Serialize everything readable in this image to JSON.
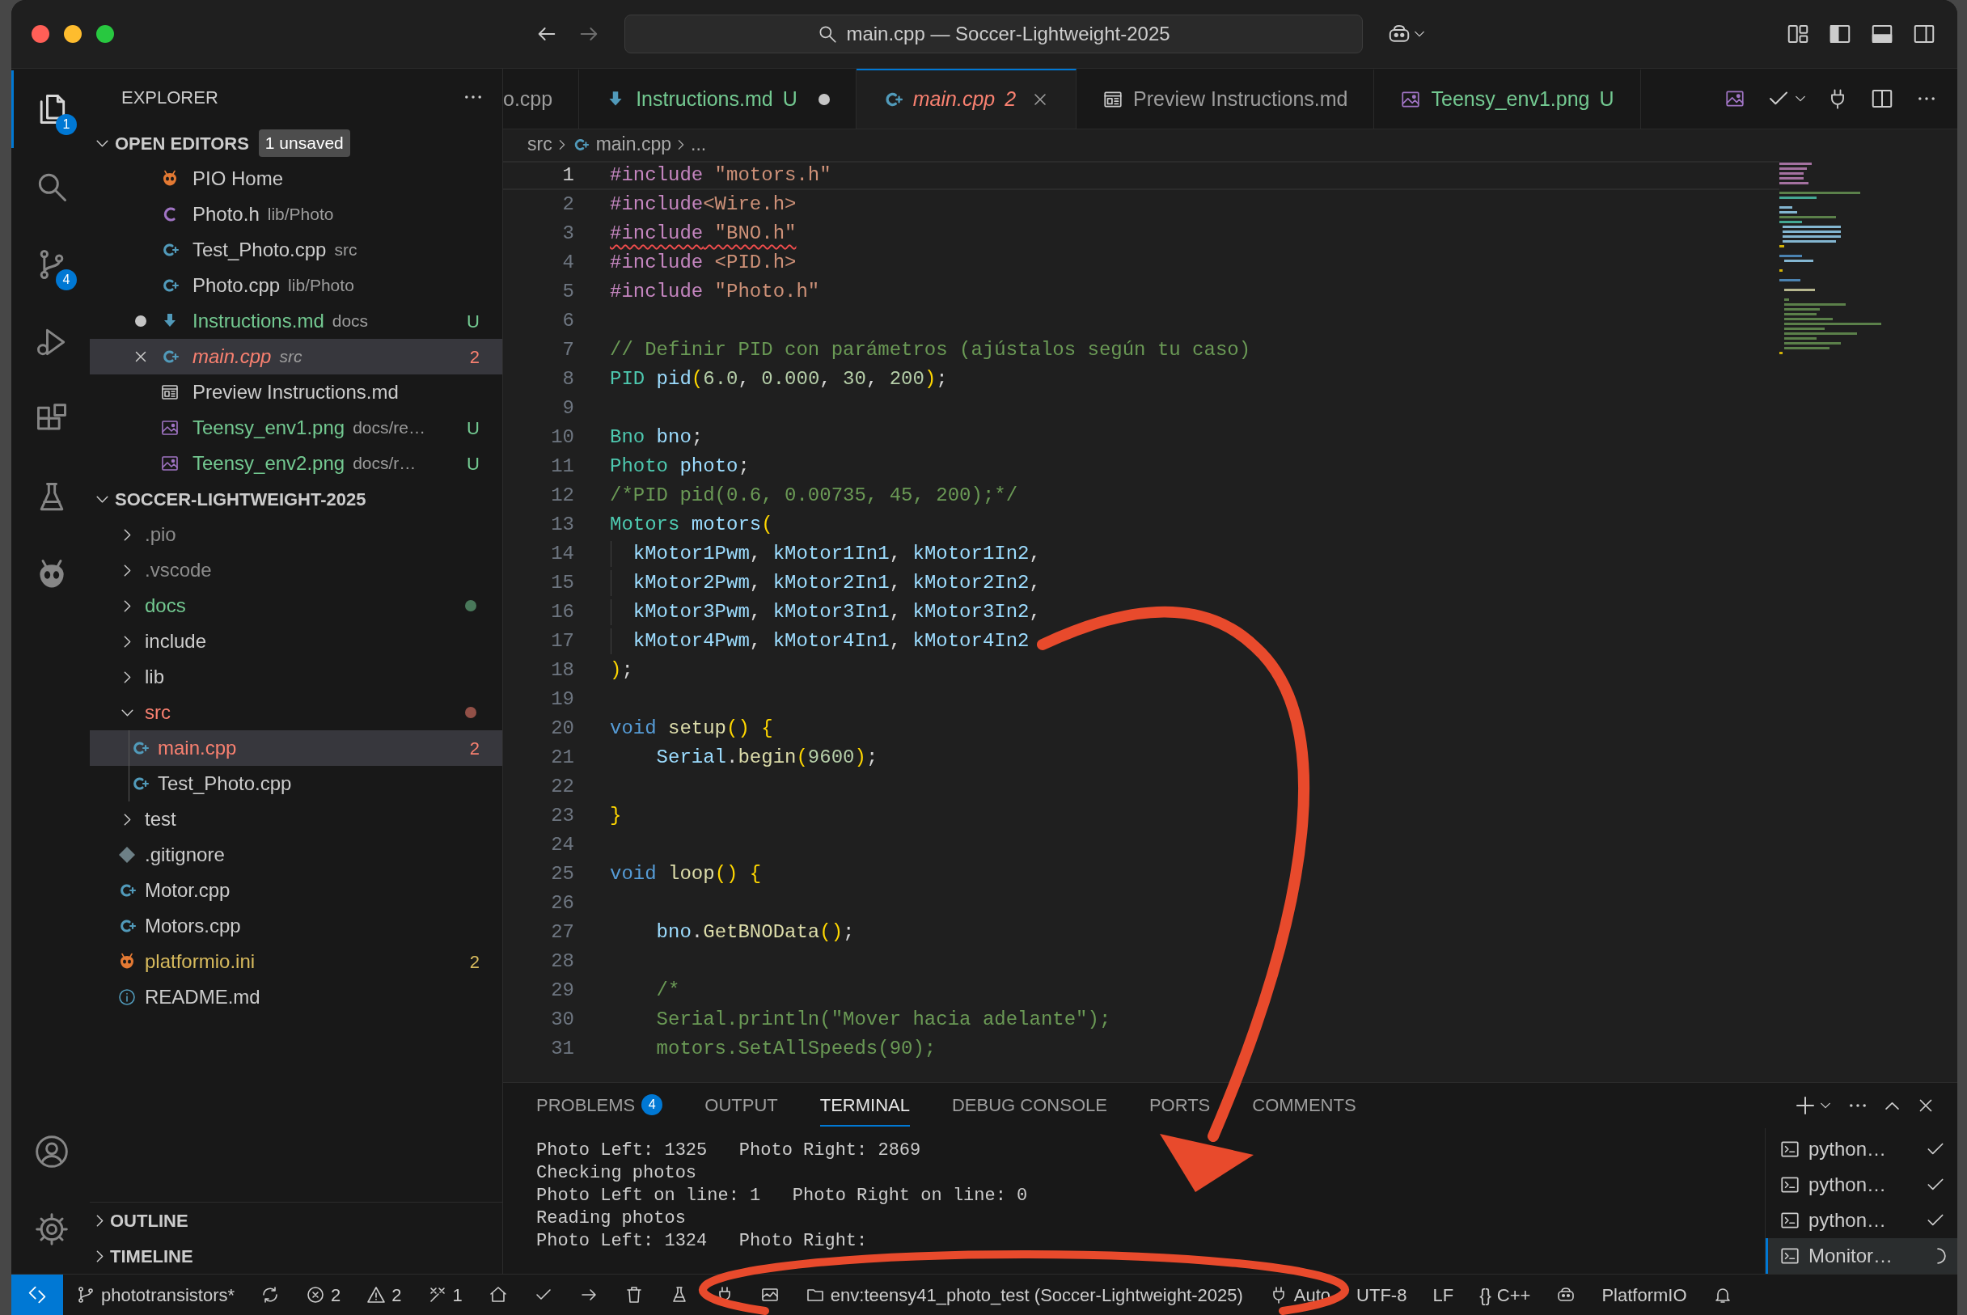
{
  "window": {
    "title": "main.cpp — Soccer-Lightweight-2025"
  },
  "activity_bar": {
    "items": [
      {
        "kind": "explorer",
        "selected": true,
        "badge": "1"
      },
      {
        "kind": "search",
        "selected": false
      },
      {
        "kind": "scm",
        "selected": false,
        "badge": "4"
      },
      {
        "kind": "run",
        "selected": false
      },
      {
        "kind": "extensions",
        "selected": false
      },
      {
        "kind": "testing",
        "selected": false
      },
      {
        "kind": "platformio",
        "selected": false
      }
    ],
    "bottom": [
      {
        "kind": "account"
      },
      {
        "kind": "settings"
      }
    ]
  },
  "sidebar": {
    "title": "EXPLORER",
    "open_editors": {
      "title": "OPEN EDITORS",
      "badge": "1 unsaved",
      "expanded": true,
      "items": [
        {
          "kind": "platformio",
          "name": "PIO Home",
          "color": "#cccccc",
          "unsaved": false,
          "selected": false
        },
        {
          "kind": "header",
          "name": "Photo.h",
          "detail": "lib/Photo",
          "color": "#cccccc",
          "unsaved": false,
          "selected": false
        },
        {
          "kind": "cpp",
          "name": "Test_Photo.cpp",
          "detail": "src",
          "color": "#cccccc",
          "unsaved": false,
          "selected": false
        },
        {
          "kind": "cpp",
          "name": "Photo.cpp",
          "detail": "lib/Photo",
          "color": "#cccccc",
          "unsaved": false,
          "selected": false
        },
        {
          "kind": "markdown",
          "name": "Instructions.md",
          "detail": "docs",
          "badge": "U",
          "color": "#73c991",
          "unsaved": true,
          "selected": false
        },
        {
          "kind": "cpp",
          "name": "main.cpp",
          "detail": "src",
          "badge": "2",
          "color": "#f88070",
          "unsaved": false,
          "preview": true,
          "selected": true
        },
        {
          "kind": "preview",
          "name": "Preview Instructions.md",
          "color": "#cccccc",
          "unsaved": false,
          "selected": false
        },
        {
          "kind": "image",
          "name": "Teensy_env1.png",
          "detail": "docs/re…",
          "badge": "U",
          "color": "#73c991",
          "unsaved": false,
          "selected": false
        },
        {
          "kind": "image",
          "name": "Teensy_env2.png",
          "detail": "docs/r…",
          "badge": "U",
          "color": "#73c991",
          "unsaved": false,
          "selected": false
        }
      ]
    },
    "workspace": {
      "title": "SOCCER-LIGHTWEIGHT-2025",
      "expanded": true,
      "items": [
        {
          "kind": "folder",
          "name": ".pio",
          "expanded": false,
          "color": "#8c8c8c",
          "selected": false
        },
        {
          "kind": "folder",
          "name": ".vscode",
          "expanded": false,
          "color": "#8c8c8c",
          "selected": false
        },
        {
          "kind": "folder",
          "name": "docs",
          "expanded": false,
          "color": "#73c991",
          "dot": true,
          "selected": false
        },
        {
          "kind": "folder",
          "name": "include",
          "expanded": false,
          "color": "#cccccc",
          "selected": false
        },
        {
          "kind": "folder",
          "name": "lib",
          "expanded": false,
          "color": "#cccccc",
          "selected": false
        },
        {
          "kind": "folder",
          "name": "src",
          "expanded": true,
          "color": "#f88070",
          "dot": true,
          "selected": false,
          "children": [
            {
              "kind": "cpp",
              "name": "main.cpp",
              "badge": "2",
              "color": "#f88070",
              "selected": true
            },
            {
              "kind": "cpp",
              "name": "Test_Photo.cpp",
              "color": "#cccccc",
              "selected": false
            }
          ]
        },
        {
          "kind": "folder",
          "name": "test",
          "expanded": false,
          "color": "#cccccc",
          "selected": false
        },
        {
          "kind": "gitignore",
          "name": ".gitignore",
          "color": "#cccccc",
          "selected": false
        },
        {
          "kind": "cpp",
          "name": "Motor.cpp",
          "color": "#cccccc",
          "selected": false
        },
        {
          "kind": "cpp",
          "name": "Motors.cpp",
          "color": "#cccccc",
          "selected": false
        },
        {
          "kind": "platformio",
          "name": "platformio.ini",
          "badge": "2",
          "color": "#d7ba5d",
          "selected": false
        },
        {
          "kind": "info",
          "name": "README.md",
          "color": "#cccccc",
          "selected": false
        }
      ]
    },
    "sections": [
      {
        "title": "OUTLINE",
        "expanded": false
      },
      {
        "title": "TIMELINE",
        "expanded": false
      }
    ]
  },
  "editor_tabs": [
    {
      "label": "o.cpp",
      "color": "#9d9d9d",
      "selected": false
    },
    {
      "kind": "markdown",
      "label": "Instructions.md",
      "badge": "U",
      "color": "#73c991",
      "unsaved": true,
      "selected": false
    },
    {
      "kind": "cpp",
      "label": "main.cpp",
      "badge": "2",
      "color": "#f88070",
      "preview": true,
      "selected": true
    },
    {
      "kind": "preview",
      "label": "Preview Instructions.md",
      "color": "#9d9d9d",
      "selected": false
    },
    {
      "kind": "image",
      "label": "Teensy_env1.png",
      "badge": "U",
      "color": "#73c991",
      "selected": false
    }
  ],
  "editor": {
    "breadcrumb": [
      {
        "text": "src"
      },
      {
        "text": "main.cpp",
        "kind": "cpp"
      },
      {
        "text": "..."
      }
    ],
    "lines": [
      {
        "n": "1",
        "current": true,
        "tokens": [
          {
            "text": "#include",
            "kind": "directive"
          },
          {
            "text": " \"motors.h\"",
            "kind": "string"
          }
        ]
      },
      {
        "n": "2",
        "current": false,
        "tokens": [
          {
            "text": "#include",
            "kind": "directive"
          },
          {
            "text": "<Wire.h>",
            "kind": "string"
          }
        ]
      },
      {
        "n": "3",
        "current": false,
        "squiggle": true,
        "tokens": [
          {
            "text": "#include",
            "kind": "directive"
          },
          {
            "text": " \"BNO.h\"",
            "kind": "string"
          }
        ]
      },
      {
        "n": "4",
        "current": false,
        "tokens": [
          {
            "text": "#include",
            "kind": "directive"
          },
          {
            "text": " <PID.h>",
            "kind": "string"
          }
        ]
      },
      {
        "n": "5",
        "current": false,
        "tokens": [
          {
            "text": "#include",
            "kind": "directive"
          },
          {
            "text": " \"Photo.h\"",
            "kind": "string"
          }
        ]
      },
      {
        "n": "6",
        "current": false
      },
      {
        "n": "7",
        "current": false,
        "tokens": [
          {
            "text": "// Definir PID con parámetros (ajústalos según tu caso)",
            "kind": "comment"
          }
        ]
      },
      {
        "n": "8",
        "current": false,
        "tokens": [
          {
            "text": "PID",
            "kind": "type"
          },
          {
            "text": " pid",
            "kind": "variable"
          },
          {
            "text": "(",
            "kind": "bracket"
          },
          {
            "text": "6.0",
            "kind": "number"
          },
          {
            "text": ", ",
            "kind": "punctuation"
          },
          {
            "text": "0.000",
            "kind": "number"
          },
          {
            "text": ", ",
            "kind": "punctuation"
          },
          {
            "text": "30",
            "kind": "number"
          },
          {
            "text": ", ",
            "kind": "punctuation"
          },
          {
            "text": "200",
            "kind": "number"
          },
          {
            "text": ")",
            "kind": "bracket"
          },
          {
            "text": ";",
            "kind": "punctuation"
          }
        ]
      },
      {
        "n": "9",
        "current": false
      },
      {
        "n": "10",
        "current": false,
        "tokens": [
          {
            "text": "Bno",
            "kind": "type"
          },
          {
            "text": " bno",
            "kind": "variable"
          },
          {
            "text": ";",
            "kind": "punctuation"
          }
        ]
      },
      {
        "n": "11",
        "current": false,
        "tokens": [
          {
            "text": "Photo",
            "kind": "type"
          },
          {
            "text": " photo",
            "kind": "variable"
          },
          {
            "text": ";",
            "kind": "punctuation"
          }
        ]
      },
      {
        "n": "12",
        "current": false,
        "tokens": [
          {
            "text": "/*PID pid(0.6, 0.00735, 45, 200);*/",
            "kind": "comment"
          }
        ]
      },
      {
        "n": "13",
        "current": false,
        "tokens": [
          {
            "text": "Motors",
            "kind": "type"
          },
          {
            "text": " motors",
            "kind": "variable"
          },
          {
            "text": "(",
            "kind": "bracket"
          }
        ]
      },
      {
        "n": "14",
        "current": false,
        "guide": true,
        "tokens": [
          {
            "text": "  kMotor1Pwm",
            "kind": "variable"
          },
          {
            "text": ", ",
            "kind": "punctuation"
          },
          {
            "text": "kMotor1In1",
            "kind": "variable"
          },
          {
            "text": ", ",
            "kind": "punctuation"
          },
          {
            "text": "kMotor1In2",
            "kind": "variable"
          },
          {
            "text": ",",
            "kind": "punctuation"
          }
        ]
      },
      {
        "n": "15",
        "current": false,
        "guide": true,
        "tokens": [
          {
            "text": "  kMotor2Pwm",
            "kind": "variable"
          },
          {
            "text": ", ",
            "kind": "punctuation"
          },
          {
            "text": "kMotor2In1",
            "kind": "variable"
          },
          {
            "text": ", ",
            "kind": "punctuation"
          },
          {
            "text": "kMotor2In2",
            "kind": "variable"
          },
          {
            "text": ",",
            "kind": "punctuation"
          }
        ]
      },
      {
        "n": "16",
        "current": false,
        "guide": true,
        "tokens": [
          {
            "text": "  kMotor3Pwm",
            "kind": "variable"
          },
          {
            "text": ", ",
            "kind": "punctuation"
          },
          {
            "text": "kMotor3In1",
            "kind": "variable"
          },
          {
            "text": ", ",
            "kind": "punctuation"
          },
          {
            "text": "kMotor3In2",
            "kind": "variable"
          },
          {
            "text": ",",
            "kind": "punctuation"
          }
        ]
      },
      {
        "n": "17",
        "current": false,
        "guide": true,
        "tokens": [
          {
            "text": "  kMotor4Pwm",
            "kind": "variable"
          },
          {
            "text": ", ",
            "kind": "punctuation"
          },
          {
            "text": "kMotor4In1",
            "kind": "variable"
          },
          {
            "text": ", ",
            "kind": "punctuation"
          },
          {
            "text": "kMotor4In2",
            "kind": "variable"
          }
        ]
      },
      {
        "n": "18",
        "current": false,
        "tokens": [
          {
            "text": ")",
            "kind": "bracket"
          },
          {
            "text": ";",
            "kind": "punctuation"
          }
        ]
      },
      {
        "n": "19",
        "current": false
      },
      {
        "n": "20",
        "current": false,
        "tokens": [
          {
            "text": "void",
            "kind": "keyword"
          },
          {
            "text": " setup",
            "kind": "function"
          },
          {
            "text": "()",
            "kind": "bracket"
          },
          {
            "text": " {",
            "kind": "bracket"
          }
        ]
      },
      {
        "n": "21",
        "current": false,
        "tokens": [
          {
            "text": "    Serial",
            "kind": "variable"
          },
          {
            "text": ".",
            "kind": "punctuation"
          },
          {
            "text": "begin",
            "kind": "function"
          },
          {
            "text": "(",
            "kind": "bracket"
          },
          {
            "text": "9600",
            "kind": "number"
          },
          {
            "text": ")",
            "kind": "bracket"
          },
          {
            "text": ";",
            "kind": "punctuation"
          }
        ]
      },
      {
        "n": "22",
        "current": false
      },
      {
        "n": "23",
        "current": false,
        "tokens": [
          {
            "text": "}",
            "kind": "bracket"
          }
        ]
      },
      {
        "n": "24",
        "current": false
      },
      {
        "n": "25",
        "current": false,
        "tokens": [
          {
            "text": "void",
            "kind": "keyword"
          },
          {
            "text": " loop",
            "kind": "function"
          },
          {
            "text": "()",
            "kind": "bracket"
          },
          {
            "text": " {",
            "kind": "bracket"
          }
        ]
      },
      {
        "n": "26",
        "current": false
      },
      {
        "n": "27",
        "current": false,
        "tokens": [
          {
            "text": "    bno",
            "kind": "variable"
          },
          {
            "text": ".",
            "kind": "punctuation"
          },
          {
            "text": "GetBNOData",
            "kind": "function"
          },
          {
            "text": "()",
            "kind": "bracket"
          },
          {
            "text": ";",
            "kind": "punctuation"
          }
        ]
      },
      {
        "n": "28",
        "current": false
      },
      {
        "n": "29",
        "current": false,
        "tokens": [
          {
            "text": "    /*",
            "kind": "comment"
          }
        ]
      },
      {
        "n": "30",
        "current": false,
        "tokens": [
          {
            "text": "    Serial.println(\"Mover hacia adelante\");",
            "kind": "comment"
          }
        ]
      },
      {
        "n": "31",
        "current": false,
        "tokens": [
          {
            "text": "    motors.SetAllSpeeds(90);",
            "kind": "comment"
          }
        ]
      }
    ]
  },
  "panel": {
    "tabs": [
      {
        "label": "PROBLEMS",
        "badge": "4",
        "selected": false
      },
      {
        "label": "OUTPUT",
        "selected": false
      },
      {
        "label": "TERMINAL",
        "selected": true
      },
      {
        "label": "DEBUG CONSOLE",
        "selected": false
      },
      {
        "label": "PORTS",
        "selected": false
      },
      {
        "label": "COMMENTS",
        "selected": false
      }
    ],
    "terminal_lines": [
      "Photo Left: 1325   Photo Right: 2869",
      "Checking photos",
      "Photo Left on line: 1   Photo Right on line: 0",
      "Reading photos",
      "Photo Left: 1324   Photo Right:"
    ],
    "terminals": [
      {
        "label": "python…",
        "kind": "done",
        "selected": false
      },
      {
        "label": "python…",
        "kind": "done",
        "selected": false
      },
      {
        "label": "python…",
        "kind": "done",
        "selected": false
      },
      {
        "label": "Monitor…",
        "kind": "running",
        "selected": true
      }
    ]
  },
  "status_bar": [
    {
      "kind": "remote"
    },
    {
      "kind": "branch",
      "text": "phototransistors*"
    },
    {
      "kind": "sync"
    },
    {
      "kind": "errors",
      "text": "2"
    },
    {
      "kind": "warnings",
      "text": "2"
    },
    {
      "kind": "tools",
      "text": "1"
    },
    {
      "kind": "home"
    },
    {
      "kind": "build"
    },
    {
      "kind": "upload"
    },
    {
      "kind": "clean"
    },
    {
      "kind": "test"
    },
    {
      "kind": "monitor"
    },
    {
      "kind": "terminal"
    },
    {
      "kind": "env",
      "text": "env:teensy41_photo_test (Soccer-Lightweight-2025)"
    },
    {
      "kind": "port",
      "text": "Auto"
    },
    {
      "kind": "text",
      "text": "UTF-8"
    },
    {
      "kind": "text",
      "text": "LF"
    },
    {
      "kind": "language",
      "braces": "{}",
      "text": "C++"
    },
    {
      "kind": "copilot"
    },
    {
      "kind": "text",
      "text": "PlatformIO"
    },
    {
      "kind": "bell"
    }
  ],
  "markup": {
    "arrow": true,
    "ellipse": true
  }
}
